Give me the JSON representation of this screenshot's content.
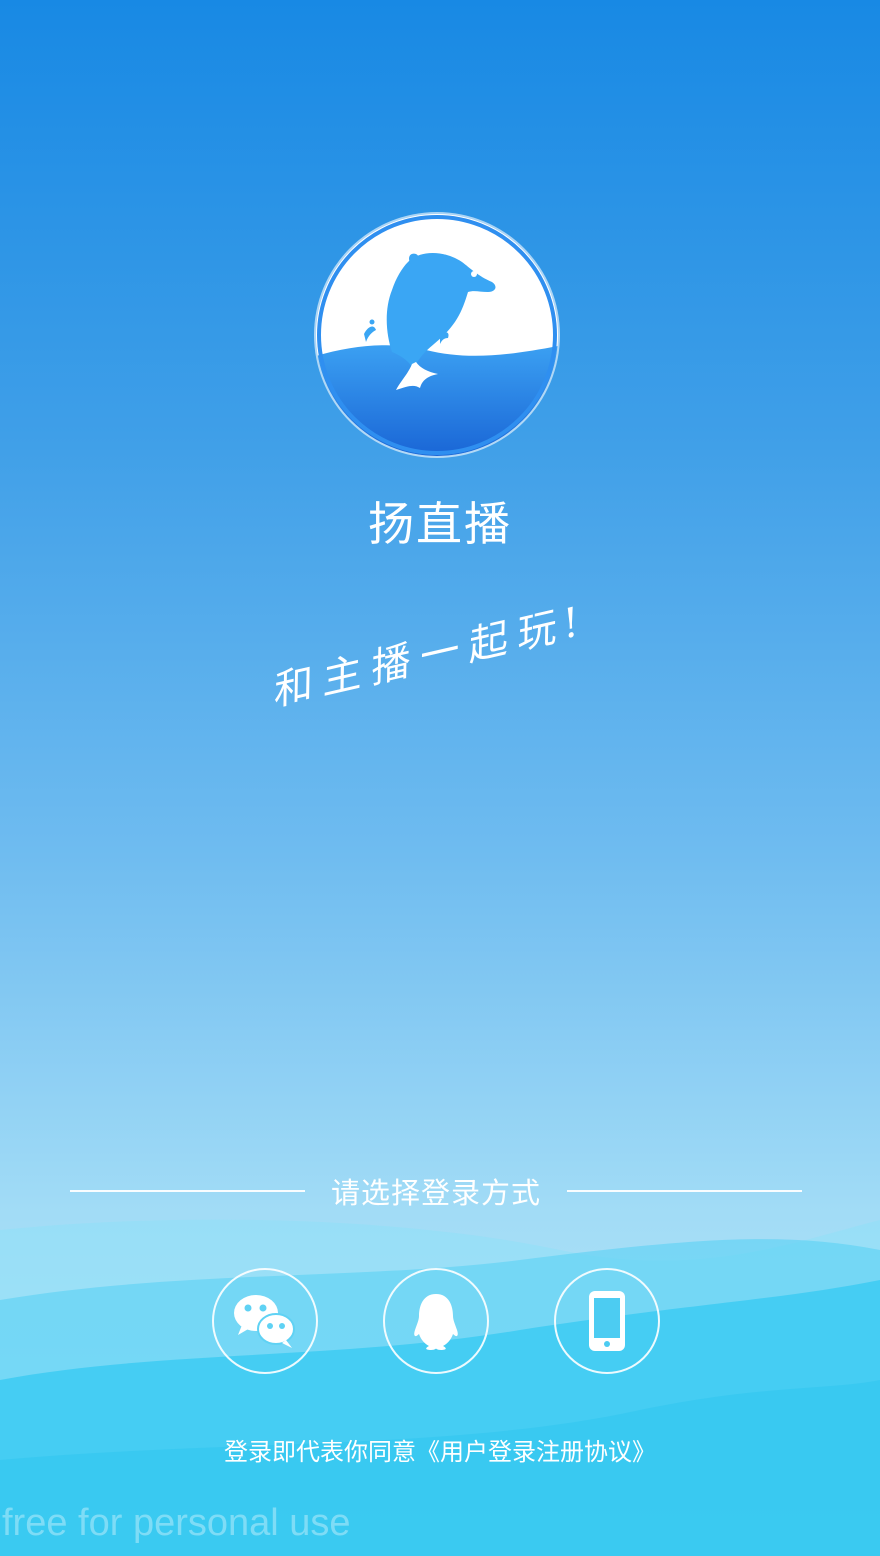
{
  "app": {
    "name": "扬直播",
    "slogan": "和主播一起玩!"
  },
  "login": {
    "prompt": "请选择登录方式",
    "options": [
      {
        "id": "wechat",
        "icon": "wechat-icon"
      },
      {
        "id": "qq",
        "icon": "qq-penguin-icon"
      },
      {
        "id": "phone",
        "icon": "mobile-phone-icon"
      }
    ]
  },
  "agreement": {
    "text": "登录即代表你同意",
    "link_text": "《用户登录注册协议》"
  },
  "watermark": "free for personal use",
  "colors": {
    "top_blue": "#1889e4",
    "bottom_light": "#bde9fa",
    "wave_cyan": "#2ec8f2",
    "logo_blue": "#2f8ff0"
  }
}
